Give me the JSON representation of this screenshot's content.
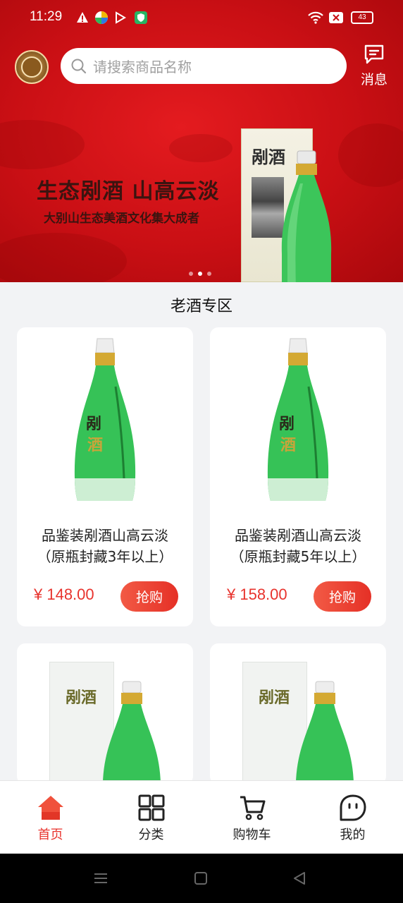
{
  "status_bar": {
    "time": "11:29",
    "battery": "43"
  },
  "header": {
    "search_placeholder": "请搜索商品名称",
    "message_label": "消息"
  },
  "banner": {
    "title": "生态剐酒 山高云淡",
    "subtitle": "大别山生态美酒文化集大成者",
    "box_brand": "剐酒",
    "active_dot": 1,
    "dot_count": 3
  },
  "section": {
    "title": "老酒专区"
  },
  "products": [
    {
      "name_line1": "品鉴装剐酒山高云淡",
      "name_line2": "（原瓶封藏3年以上）",
      "price": "¥ 148.00",
      "buy_label": "抢购"
    },
    {
      "name_line1": "品鉴装剐酒山高云淡",
      "name_line2": "（原瓶封藏5年以上）",
      "price": "¥ 158.00",
      "buy_label": "抢购"
    },
    {
      "box_brand": "剐酒"
    },
    {
      "box_brand": "剐酒"
    }
  ],
  "tabbar": [
    {
      "label": "首页",
      "icon": "home-icon",
      "active": true
    },
    {
      "label": "分类",
      "icon": "grid-icon",
      "active": false
    },
    {
      "label": "购物车",
      "icon": "cart-icon",
      "active": false
    },
    {
      "label": "我的",
      "icon": "profile-icon",
      "active": false
    }
  ],
  "colors": {
    "brand_red": "#d11419",
    "price_red": "#e8332d",
    "bottle_green": "#3cc55a"
  }
}
